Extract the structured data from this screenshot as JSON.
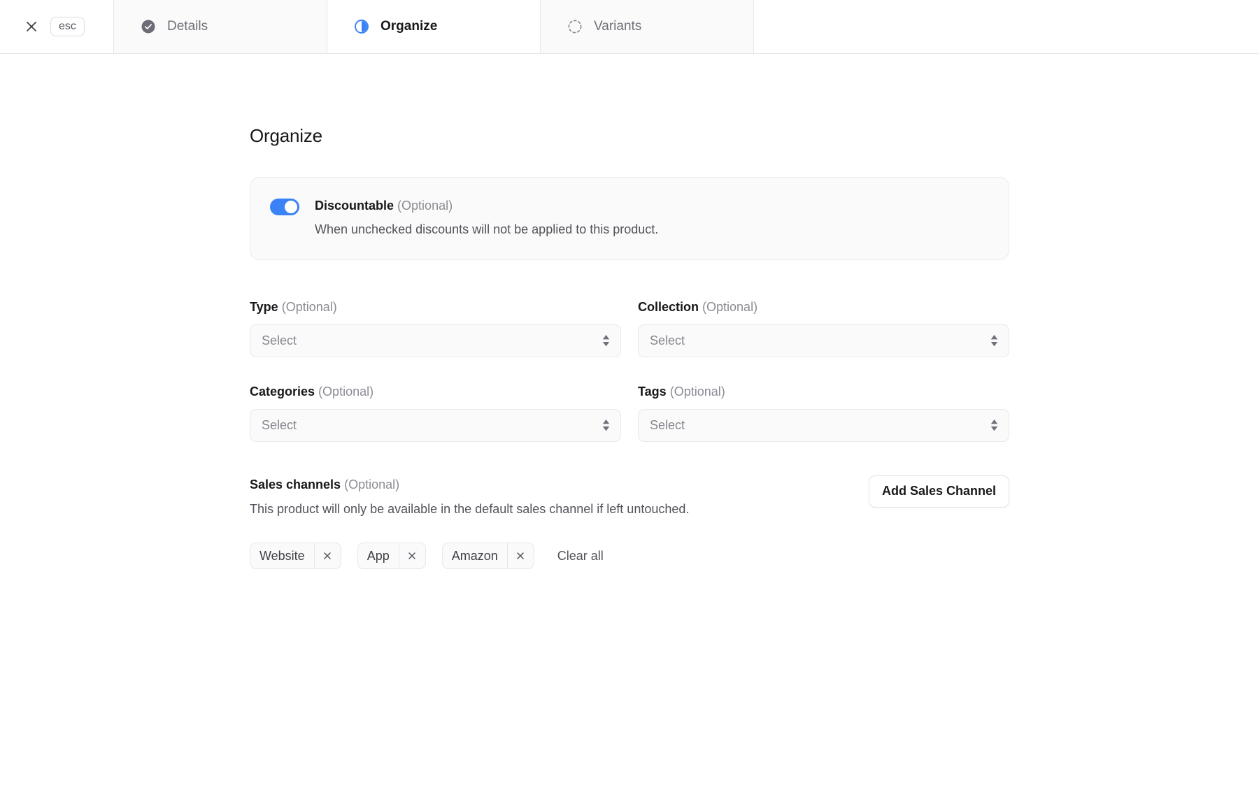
{
  "header": {
    "close_icon": "close-icon",
    "esc_label": "esc",
    "tabs": [
      {
        "label": "Details",
        "icon": "check-circle-filled-icon",
        "state": "complete",
        "active": false
      },
      {
        "label": "Organize",
        "icon": "half-filled-circle-icon",
        "state": "in-progress",
        "active": true
      },
      {
        "label": "Variants",
        "icon": "dashed-circle-icon",
        "state": "pending",
        "active": false
      }
    ]
  },
  "main": {
    "title": "Organize",
    "discountable": {
      "label": "Discountable",
      "optional": "(Optional)",
      "description": "When unchecked discounts will not be applied to this product.",
      "enabled": true
    },
    "fields": [
      {
        "label": "Type",
        "optional": "(Optional)",
        "value": "Select"
      },
      {
        "label": "Collection",
        "optional": "(Optional)",
        "value": "Select"
      },
      {
        "label": "Categories",
        "optional": "(Optional)",
        "value": "Select"
      },
      {
        "label": "Tags",
        "optional": "(Optional)",
        "value": "Select"
      }
    ],
    "sales_channels": {
      "label": "Sales channels",
      "optional": "(Optional)",
      "description": "This product will only be available in the default sales channel if left untouched.",
      "add_button": "Add Sales Channel",
      "chips": [
        "Website",
        "App",
        "Amazon"
      ],
      "clear_all": "Clear all"
    }
  },
  "colors": {
    "accent": "#3b82f6",
    "text_primary": "#18181b",
    "text_muted": "#8b8b94",
    "panel_bg": "#fafafa",
    "border": "#e7e7e9"
  }
}
